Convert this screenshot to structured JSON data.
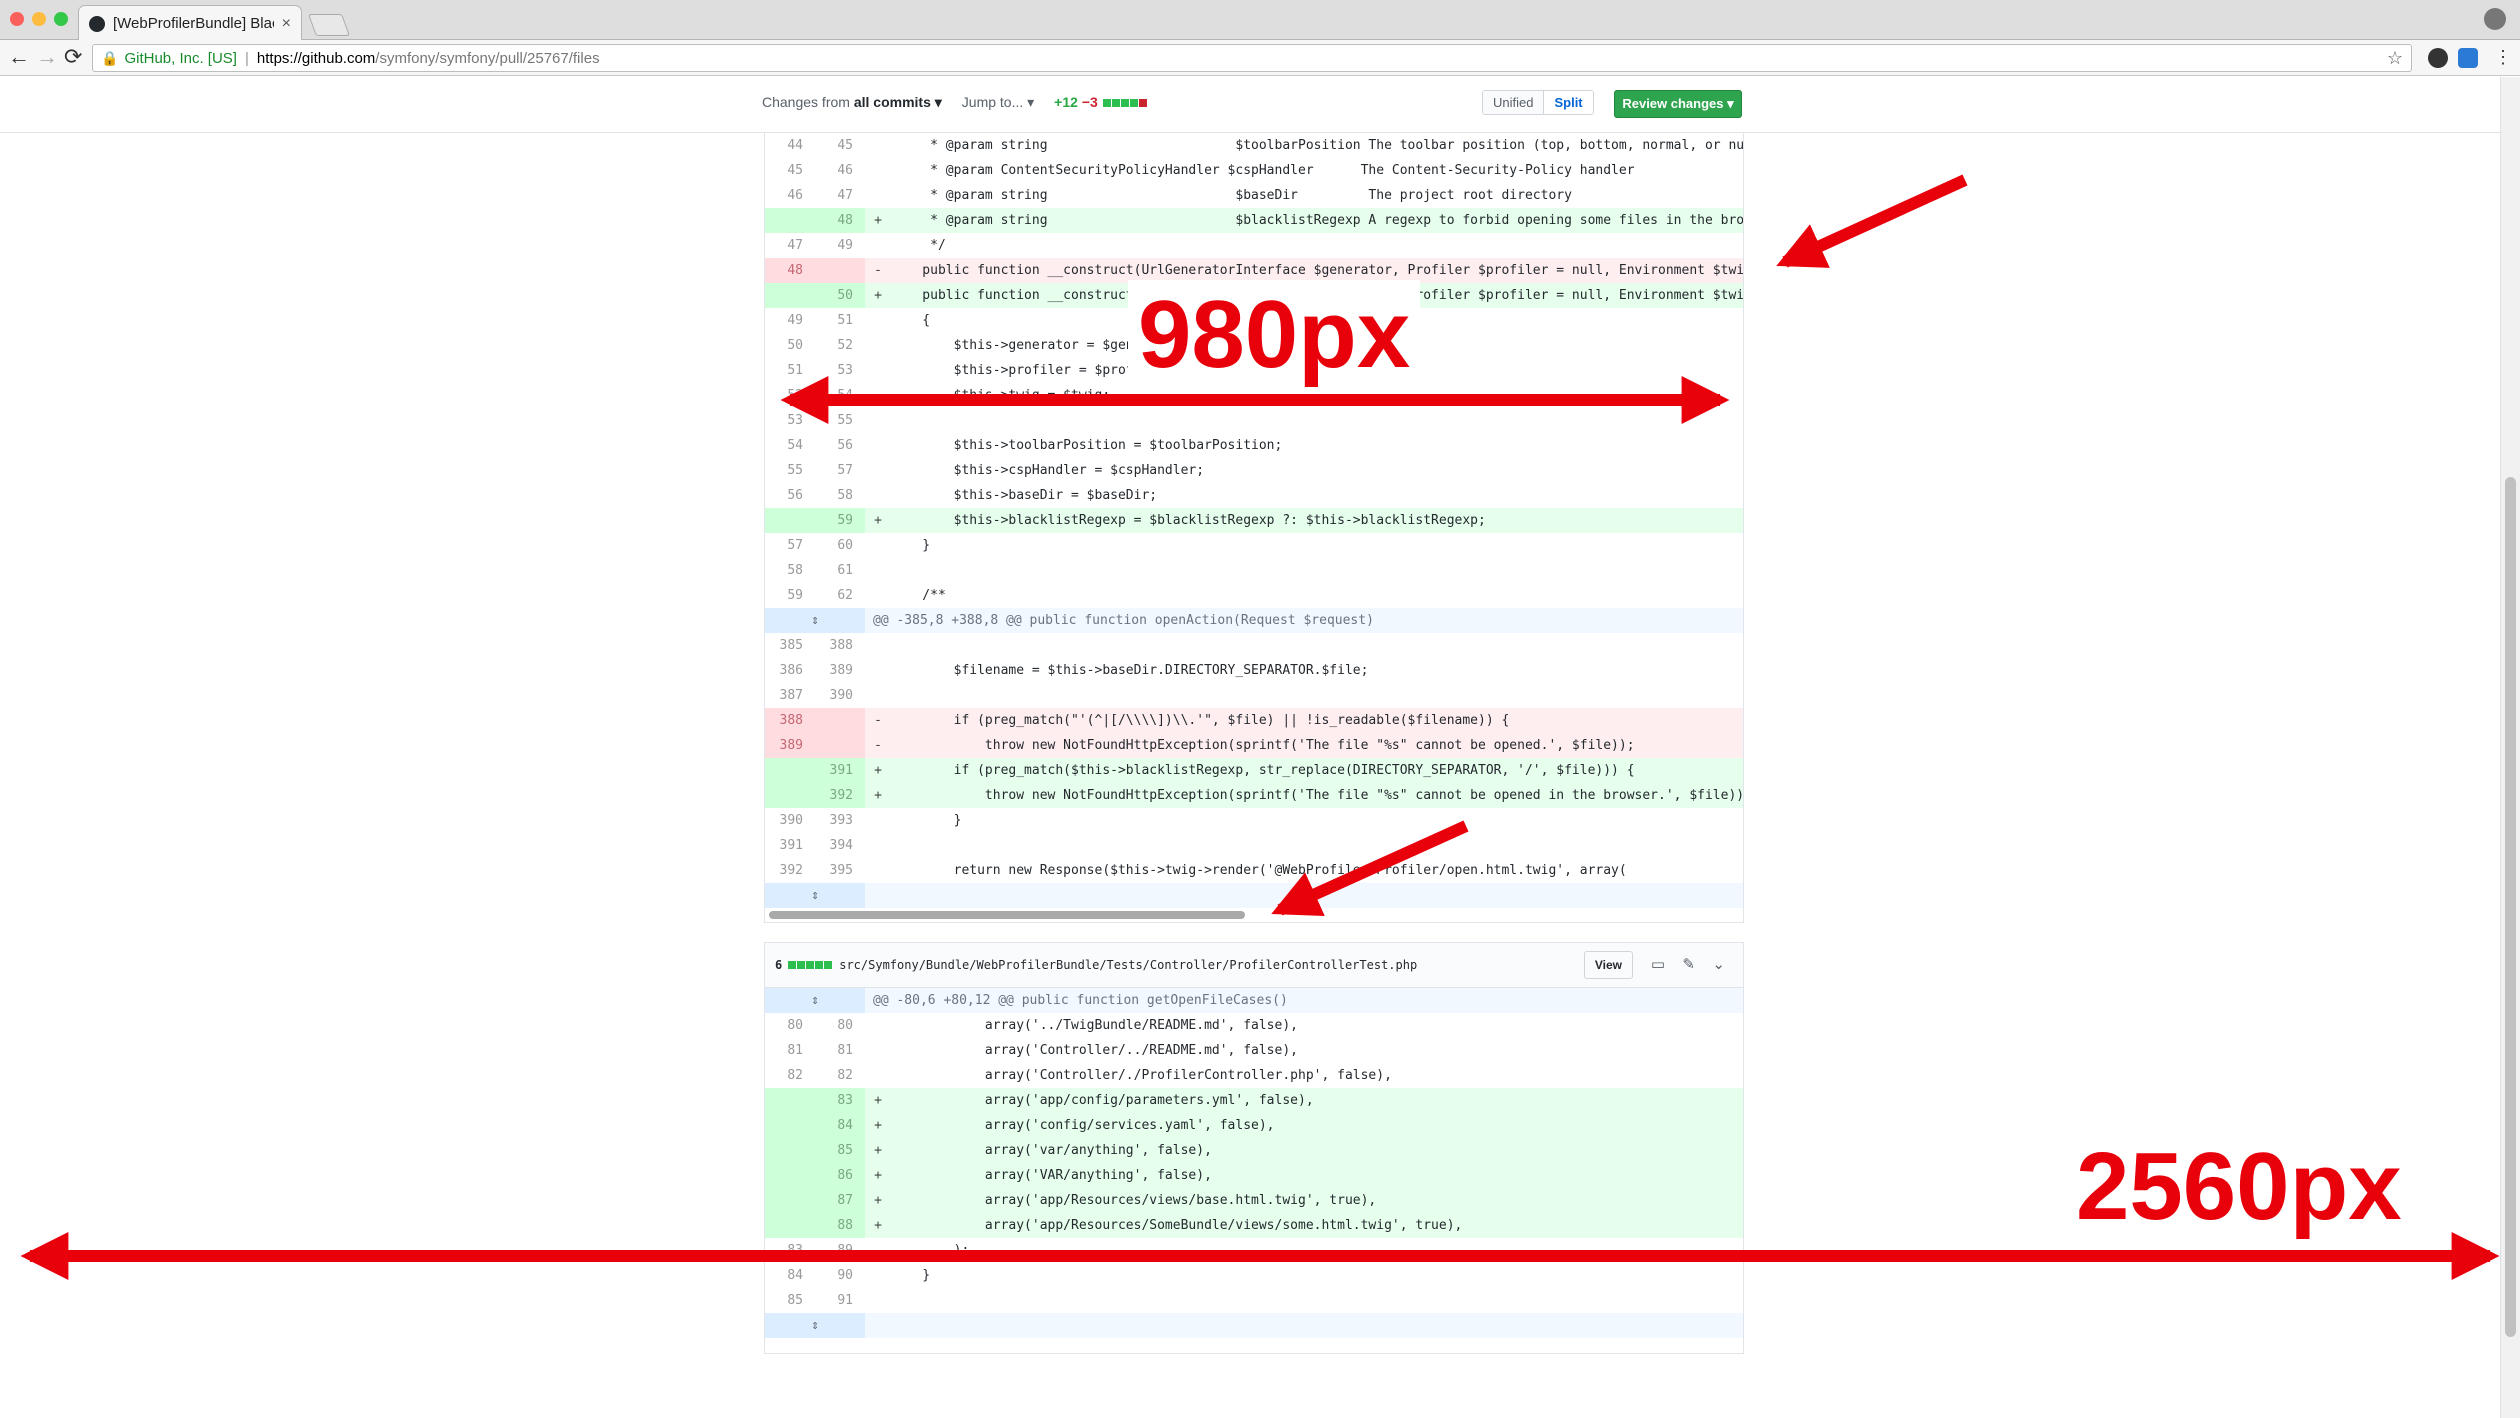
{
  "browser": {
    "tab_title": "[WebProfilerBundle] Blacklis",
    "tab_close": "×",
    "security_label": "GitHub, Inc. [US]",
    "url_host": "https://github.com",
    "url_path": "/symfony/symfony/pull/25767/files",
    "back": "←",
    "forward": "→",
    "reload": "⟳",
    "star": "☆"
  },
  "pr_toolbar": {
    "changes_from_prefix": "Changes from",
    "changes_from_value": "all commits ▾",
    "jump_to": "Jump to... ▾",
    "additions": "+12",
    "deletions": "−3",
    "unified_label": "Unified",
    "split_label": "Split",
    "review_label": "Review changes ▾"
  },
  "colors": {
    "add": "#2cbe4e",
    "del": "#cb2431",
    "annotation": "#e8000b"
  },
  "file2": {
    "count": "6",
    "path": "src/Symfony/Bundle/WebProfilerBundle/Tests/Controller/ProfilerControllerTest.php",
    "view_label": "View",
    "icons": [
      "desktop-icon",
      "pencil-icon",
      "chevron-down-icon"
    ]
  },
  "annotations": {
    "width_diff": "980px",
    "width_screen": "2560px"
  },
  "diff1_lines": [
    {
      "t": "ctx",
      "o": "44",
      "n": "45",
      "c": "     * @param string                        $toolbarPosition The toolbar position (top, bottom, normal, or null -- u"
    },
    {
      "t": "ctx",
      "o": "45",
      "n": "46",
      "c": "     * @param ContentSecurityPolicyHandler $cspHandler      The Content-Security-Policy handler"
    },
    {
      "t": "ctx",
      "o": "46",
      "n": "47",
      "c": "     * @param string                        $baseDir         The project root directory"
    },
    {
      "t": "add",
      "o": "",
      "n": "48",
      "c": "     * @param string                        $blacklistRegexp A regexp to forbid opening some files in the browser"
    },
    {
      "t": "ctx",
      "o": "47",
      "n": "49",
      "c": "     */"
    },
    {
      "t": "del",
      "o": "48",
      "n": "",
      "c": "    public function __construct(UrlGeneratorInterface $generator, Profiler $profiler = null, Environment $twig, arr"
    },
    {
      "t": "add",
      "o": "",
      "n": "50",
      "c": "    public function __construct(UrlGeneratorInterface $generator, Profiler $profiler = null, Environment $twig, arr"
    },
    {
      "t": "ctx",
      "o": "49",
      "n": "51",
      "c": "    {"
    },
    {
      "t": "ctx",
      "o": "50",
      "n": "52",
      "c": "        $this->generator = $generator;"
    },
    {
      "t": "ctx",
      "o": "51",
      "n": "53",
      "c": "        $this->profiler = $profiler;"
    },
    {
      "t": "ctx",
      "o": "52",
      "n": "54",
      "c": "        $this->twig = $twig;"
    },
    {
      "t": "ctx",
      "o": "53",
      "n": "55",
      "c": ""
    },
    {
      "t": "ctx",
      "o": "54",
      "n": "56",
      "c": "        $this->toolbarPosition = $toolbarPosition;"
    },
    {
      "t": "ctx",
      "o": "55",
      "n": "57",
      "c": "        $this->cspHandler = $cspHandler;"
    },
    {
      "t": "ctx",
      "o": "56",
      "n": "58",
      "c": "        $this->baseDir = $baseDir;"
    },
    {
      "t": "add",
      "o": "",
      "n": "59",
      "c": "        $this->blacklistRegexp = $blacklistRegexp ?: $this->blacklistRegexp;"
    },
    {
      "t": "ctx",
      "o": "57",
      "n": "60",
      "c": "    }"
    },
    {
      "t": "ctx",
      "o": "58",
      "n": "61",
      "c": ""
    },
    {
      "t": "ctx",
      "o": "59",
      "n": "62",
      "c": "    /**"
    },
    {
      "t": "hunk",
      "o": "",
      "n": "",
      "c": "@@ -385,8 +388,8 @@ public function openAction(Request $request)"
    },
    {
      "t": "ctx",
      "o": "385",
      "n": "388",
      "c": ""
    },
    {
      "t": "ctx",
      "o": "386",
      "n": "389",
      "c": "        $filename = $this->baseDir.DIRECTORY_SEPARATOR.$file;"
    },
    {
      "t": "ctx",
      "o": "387",
      "n": "390",
      "c": ""
    },
    {
      "t": "del",
      "o": "388",
      "n": "",
      "c": "        if (preg_match(\"'(^|[/\\\\\\\\])\\\\.'\", $file) || !is_readable($filename)) {"
    },
    {
      "t": "del",
      "o": "389",
      "n": "",
      "c": "            throw new NotFoundHttpException(sprintf('The file \"%s\" cannot be opened.', $file));"
    },
    {
      "t": "add",
      "o": "",
      "n": "391",
      "c": "        if (preg_match($this->blacklistRegexp, str_replace(DIRECTORY_SEPARATOR, '/', $file))) {"
    },
    {
      "t": "add",
      "o": "",
      "n": "392",
      "c": "            throw new NotFoundHttpException(sprintf('The file \"%s\" cannot be opened in the browser.', $file));"
    },
    {
      "t": "ctx",
      "o": "390",
      "n": "393",
      "c": "        }"
    },
    {
      "t": "ctx",
      "o": "391",
      "n": "394",
      "c": ""
    },
    {
      "t": "ctx",
      "o": "392",
      "n": "395",
      "c": "        return new Response($this->twig->render('@WebProfiler/Profiler/open.html.twig', array("
    },
    {
      "t": "expand",
      "o": "",
      "n": "",
      "c": ""
    }
  ],
  "diff2_lines": [
    {
      "t": "hunk",
      "o": "",
      "n": "",
      "c": "@@ -80,6 +80,12 @@ public function getOpenFileCases()"
    },
    {
      "t": "ctx",
      "o": "80",
      "n": "80",
      "c": "            array('../TwigBundle/README.md', false),"
    },
    {
      "t": "ctx",
      "o": "81",
      "n": "81",
      "c": "            array('Controller/../README.md', false),"
    },
    {
      "t": "ctx",
      "o": "82",
      "n": "82",
      "c": "            array('Controller/./ProfilerController.php', false),"
    },
    {
      "t": "add",
      "o": "",
      "n": "83",
      "c": "            array('app/config/parameters.yml', false),"
    },
    {
      "t": "add",
      "o": "",
      "n": "84",
      "c": "            array('config/services.yaml', false),"
    },
    {
      "t": "add",
      "o": "",
      "n": "85",
      "c": "            array('var/anything', false),"
    },
    {
      "t": "add",
      "o": "",
      "n": "86",
      "c": "            array('VAR/anything', false),"
    },
    {
      "t": "add",
      "o": "",
      "n": "87",
      "c": "            array('app/Resources/views/base.html.twig', true),"
    },
    {
      "t": "add",
      "o": "",
      "n": "88",
      "c": "            array('app/Resources/SomeBundle/views/some.html.twig', true),"
    },
    {
      "t": "ctx",
      "o": "83",
      "n": "89",
      "c": "        );"
    },
    {
      "t": "ctx",
      "o": "84",
      "n": "90",
      "c": "    }"
    },
    {
      "t": "ctx",
      "o": "85",
      "n": "91",
      "c": ""
    },
    {
      "t": "expand",
      "o": "",
      "n": "",
      "c": ""
    }
  ]
}
